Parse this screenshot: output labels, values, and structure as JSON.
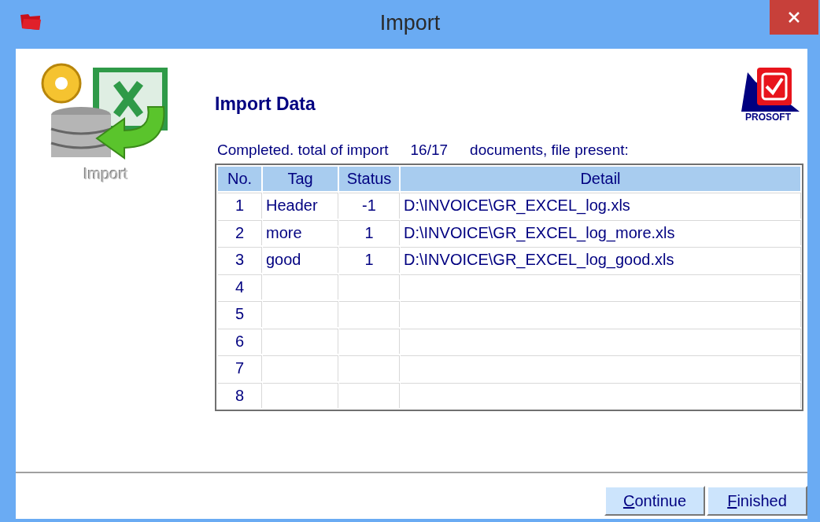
{
  "window": {
    "title": "Import"
  },
  "side_icon": {
    "caption": "Import"
  },
  "logo": {
    "text": "PROSOFT"
  },
  "heading": "Import Data",
  "summary": {
    "prefix": "Completed.  total of import",
    "count": "16/17",
    "suffix": "documents, file present:"
  },
  "table": {
    "columns": [
      "No.",
      "Tag",
      "Status",
      "Detail"
    ],
    "rows": [
      {
        "no": "1",
        "tag": "Header",
        "status": "-1",
        "detail": "D:\\INVOICE\\GR_EXCEL_log.xls"
      },
      {
        "no": "2",
        "tag": "more",
        "status": "1",
        "detail": "D:\\INVOICE\\GR_EXCEL_log_more.xls"
      },
      {
        "no": "3",
        "tag": "good",
        "status": "1",
        "detail": "D:\\INVOICE\\GR_EXCEL_log_good.xls"
      },
      {
        "no": "4"
      },
      {
        "no": "5"
      },
      {
        "no": "6"
      },
      {
        "no": "7"
      },
      {
        "no": "8"
      }
    ]
  },
  "buttons": [
    {
      "label": "Continue",
      "first_letter_underlined": true
    },
    {
      "label": "Finished",
      "first_letter_underlined": true
    }
  ]
}
